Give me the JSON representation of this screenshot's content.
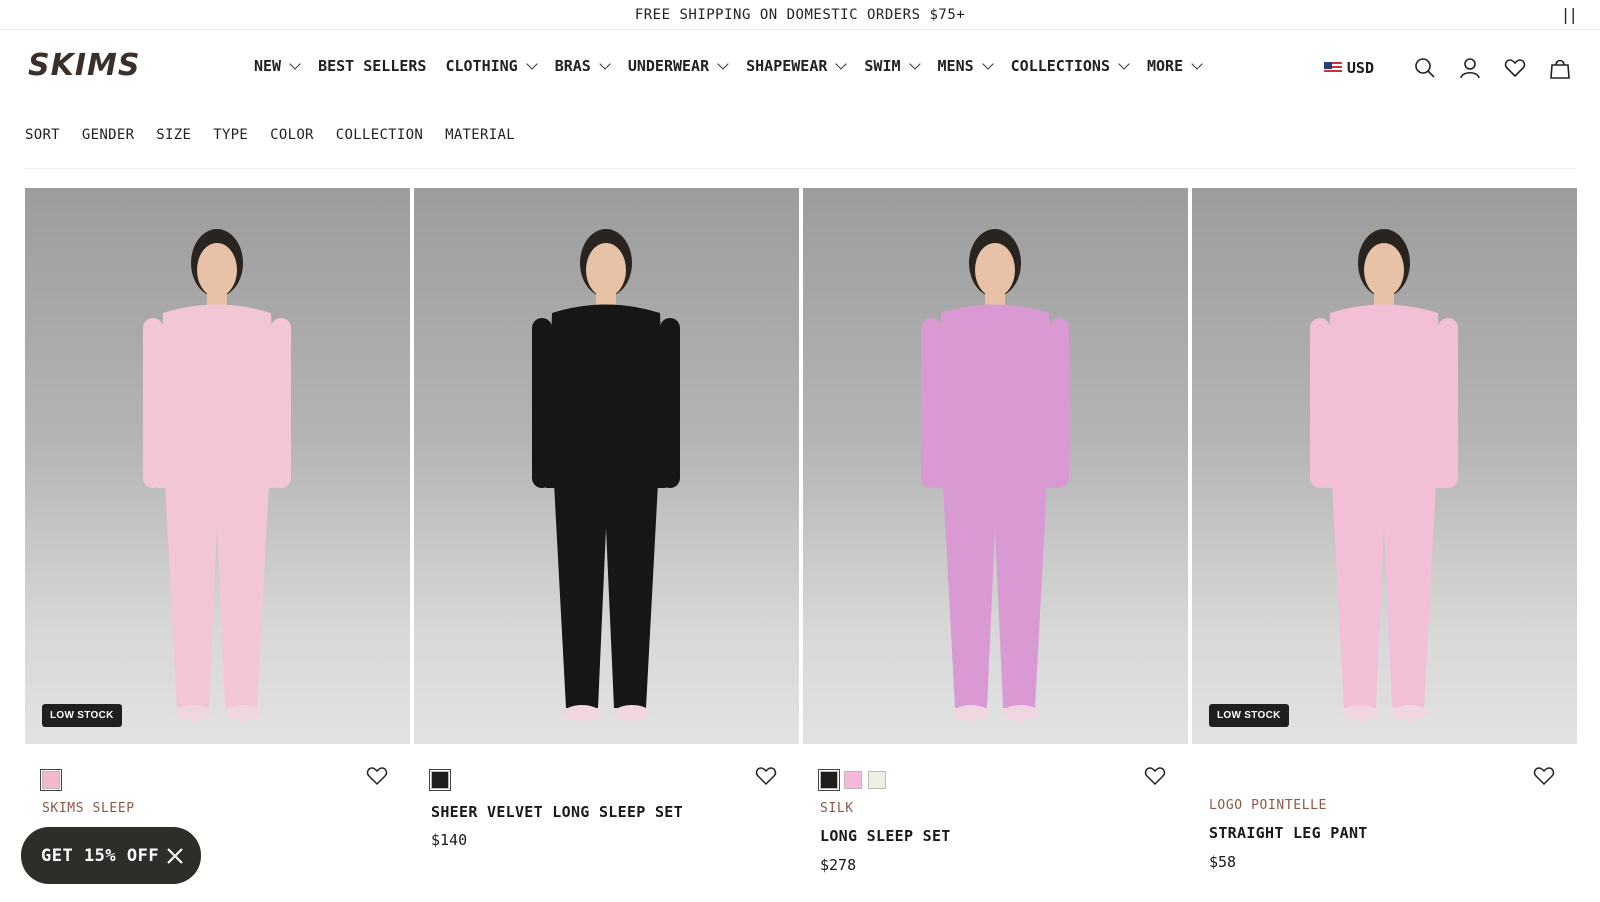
{
  "announcement": {
    "text": "FREE SHIPPING ON DOMESTIC ORDERS $75+",
    "pause_icon": "pause-icon"
  },
  "header": {
    "logo": "SKIMS",
    "nav": [
      {
        "label": "NEW",
        "dropdown": true
      },
      {
        "label": "BEST SELLERS",
        "dropdown": false
      },
      {
        "label": "CLOTHING",
        "dropdown": true
      },
      {
        "label": "BRAS",
        "dropdown": true
      },
      {
        "label": "UNDERWEAR",
        "dropdown": true
      },
      {
        "label": "SHAPEWEAR",
        "dropdown": true
      },
      {
        "label": "SWIM",
        "dropdown": true
      },
      {
        "label": "MENS",
        "dropdown": true
      },
      {
        "label": "COLLECTIONS",
        "dropdown": true
      },
      {
        "label": "MORE",
        "dropdown": true
      }
    ],
    "currency": "USD",
    "icons": [
      "search-icon",
      "account-icon",
      "wishlist-icon",
      "bag-icon"
    ]
  },
  "filters": [
    "SORT",
    "GENDER",
    "SIZE",
    "TYPE",
    "COLOR",
    "COLLECTION",
    "MATERIAL"
  ],
  "products": [
    {
      "badge": "LOW STOCK",
      "swatches": [
        "#f2b9c8"
      ],
      "subtitle": "SKIMS SLEEP",
      "name": "",
      "price": "",
      "photo_color": "#f3c6d3"
    },
    {
      "badge": "",
      "swatches": [
        "#1e1e1e"
      ],
      "subtitle": "",
      "name": "SHEER VELVET LONG SLEEP SET",
      "price": "$140",
      "photo_color": "#161616"
    },
    {
      "badge": "",
      "swatches": [
        "#1e1e1e",
        "#f5b7dc",
        "#eef0e2"
      ],
      "subtitle": "SILK",
      "name": "LONG SLEEP SET",
      "price": "$278",
      "photo_color": "#d99ad4"
    },
    {
      "badge": "LOW STOCK",
      "swatches": [],
      "subtitle": "LOGO POINTELLE",
      "name": "STRAIGHT LEG PANT",
      "price": "$58",
      "photo_color": "#f2bfd6"
    }
  ],
  "promo": {
    "label": "GET 15% OFF"
  }
}
